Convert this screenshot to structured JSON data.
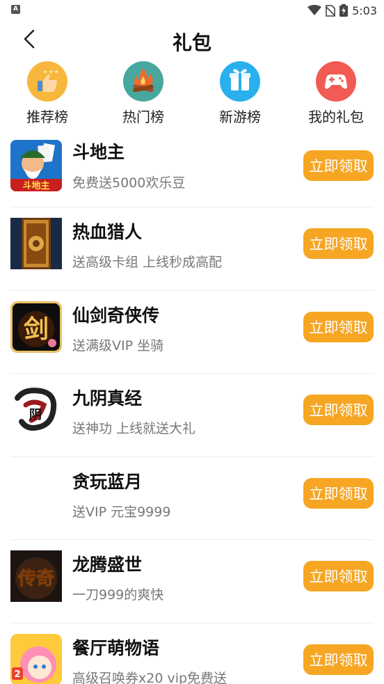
{
  "status_bar": {
    "notif_glyph": "A",
    "time": "5:03"
  },
  "header": {
    "title": "礼包"
  },
  "categories": [
    {
      "label": "推荐榜",
      "icon": "thumbs-up-icon",
      "bg": "#f6b73c"
    },
    {
      "label": "热门榜",
      "icon": "campfire-icon",
      "bg": "#48a8a0"
    },
    {
      "label": "新游榜",
      "icon": "gift-box-icon",
      "bg": "#2ab0ec"
    },
    {
      "label": "我的礼包",
      "icon": "gamepad-icon",
      "bg": "#f25b54"
    }
  ],
  "games": [
    {
      "name": "斗地主",
      "desc": "免费送5000欢乐豆",
      "button": "立即领取"
    },
    {
      "name": "热血猎人",
      "desc": "送高级卡组 上线秒成高配",
      "button": "立即领取"
    },
    {
      "name": "仙剑奇侠传",
      "desc": "送满级VIP 坐骑",
      "button": "立即领取"
    },
    {
      "name": "九阴真经",
      "desc": "送神功 上线就送大礼",
      "button": "立即领取"
    },
    {
      "name": "贪玩蓝月",
      "desc": "送VIP 元宝9999",
      "button": "立即领取"
    },
    {
      "name": "龙腾盛世",
      "desc": "一刀999的爽快",
      "button": "立即领取"
    },
    {
      "name": "餐厅萌物语",
      "desc": "高级召唤券x20 vip免费送",
      "button": "立即领取"
    }
  ],
  "thumb_glyphs": {
    "doudizhu": "斗地主",
    "xianjian": "剑",
    "jiuyin": "阴",
    "longteng": "传奇",
    "canting": "2"
  },
  "colors": {
    "accent": "#f6a623"
  }
}
